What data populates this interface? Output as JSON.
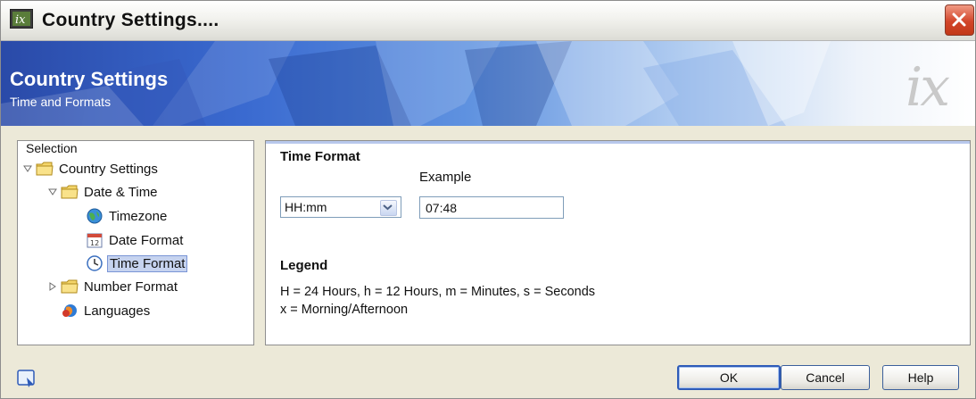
{
  "window": {
    "title": "Country Settings....",
    "close_label": "close"
  },
  "banner": {
    "title": "Country Settings",
    "subtitle": "Time and Formats",
    "logo_text": "ix"
  },
  "tree": {
    "header": "Selection",
    "items": [
      {
        "label": "Country Settings",
        "icon": "folder-icon",
        "expander": "expanded"
      },
      {
        "label": "Date & Time",
        "icon": "folder-icon",
        "expander": "expanded"
      },
      {
        "label": "Timezone",
        "icon": "globe-icon",
        "expander": "none"
      },
      {
        "label": "Date Format",
        "icon": "calendar-icon",
        "expander": "none"
      },
      {
        "label": "Time Format",
        "icon": "clock-icon",
        "expander": "none",
        "selected": true
      },
      {
        "label": "Number Format",
        "icon": "folder-icon",
        "expander": "collapsed"
      },
      {
        "label": "Languages",
        "icon": "languages-icon",
        "expander": "none"
      }
    ]
  },
  "time_format": {
    "title": "Time Format",
    "example_label": "Example",
    "selected_format": "HH:mm",
    "example_value": "07:48"
  },
  "legend": {
    "title": "Legend",
    "line1": "H = 24 Hours, h = 12 Hours, m = Minutes, s = Seconds",
    "line2": "x = Morning/Afternoon"
  },
  "buttons": {
    "ok": "OK",
    "cancel": "Cancel",
    "help": "Help"
  },
  "colors": {
    "accent": "#2e5bb8",
    "selection": "#c6d3ef",
    "close_red": "#d2452a"
  }
}
